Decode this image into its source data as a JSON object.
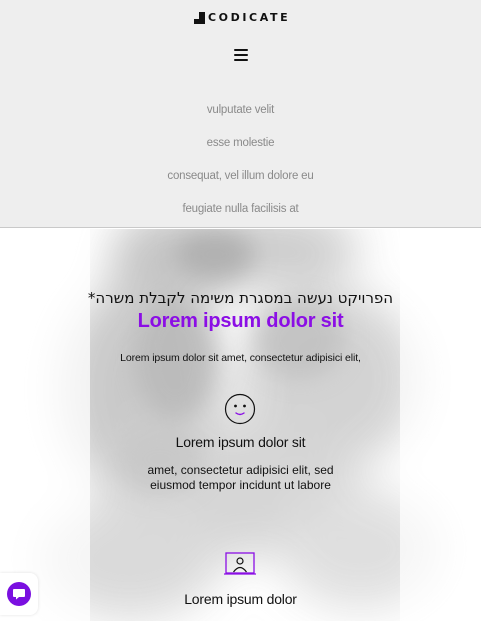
{
  "brand": {
    "name": "CODICATE"
  },
  "nav": {
    "items": [
      {
        "label": "vulputate velit"
      },
      {
        "label": "esse molestie"
      },
      {
        "label": "consequat, vel illum dolore eu"
      },
      {
        "label": "feugiate nulla facilisis at"
      }
    ]
  },
  "hero": {
    "hebrew": "הפרויקט נעשה במסגרת משימה לקבלת משרה*",
    "title": "Lorem ipsum dolor sit",
    "subtitle": "Lorem ipsum dolor sit amet, consectetur adipisici elit,"
  },
  "features": [
    {
      "icon": "smiley-face-icon",
      "title": "Lorem ipsum dolor sit",
      "text": "amet, consectetur adipisici elit, sed eiusmod tempor incidunt ut labore"
    },
    {
      "icon": "person-screen-icon",
      "title": "Lorem ipsum dolor"
    }
  ],
  "colors": {
    "accent": "#8b0ee5",
    "header_bg": "#eeeeee",
    "nav_text": "#8a8a8a",
    "chat_button": "#7a0fe0"
  },
  "chat": {
    "icon": "chat-bubble-icon"
  }
}
